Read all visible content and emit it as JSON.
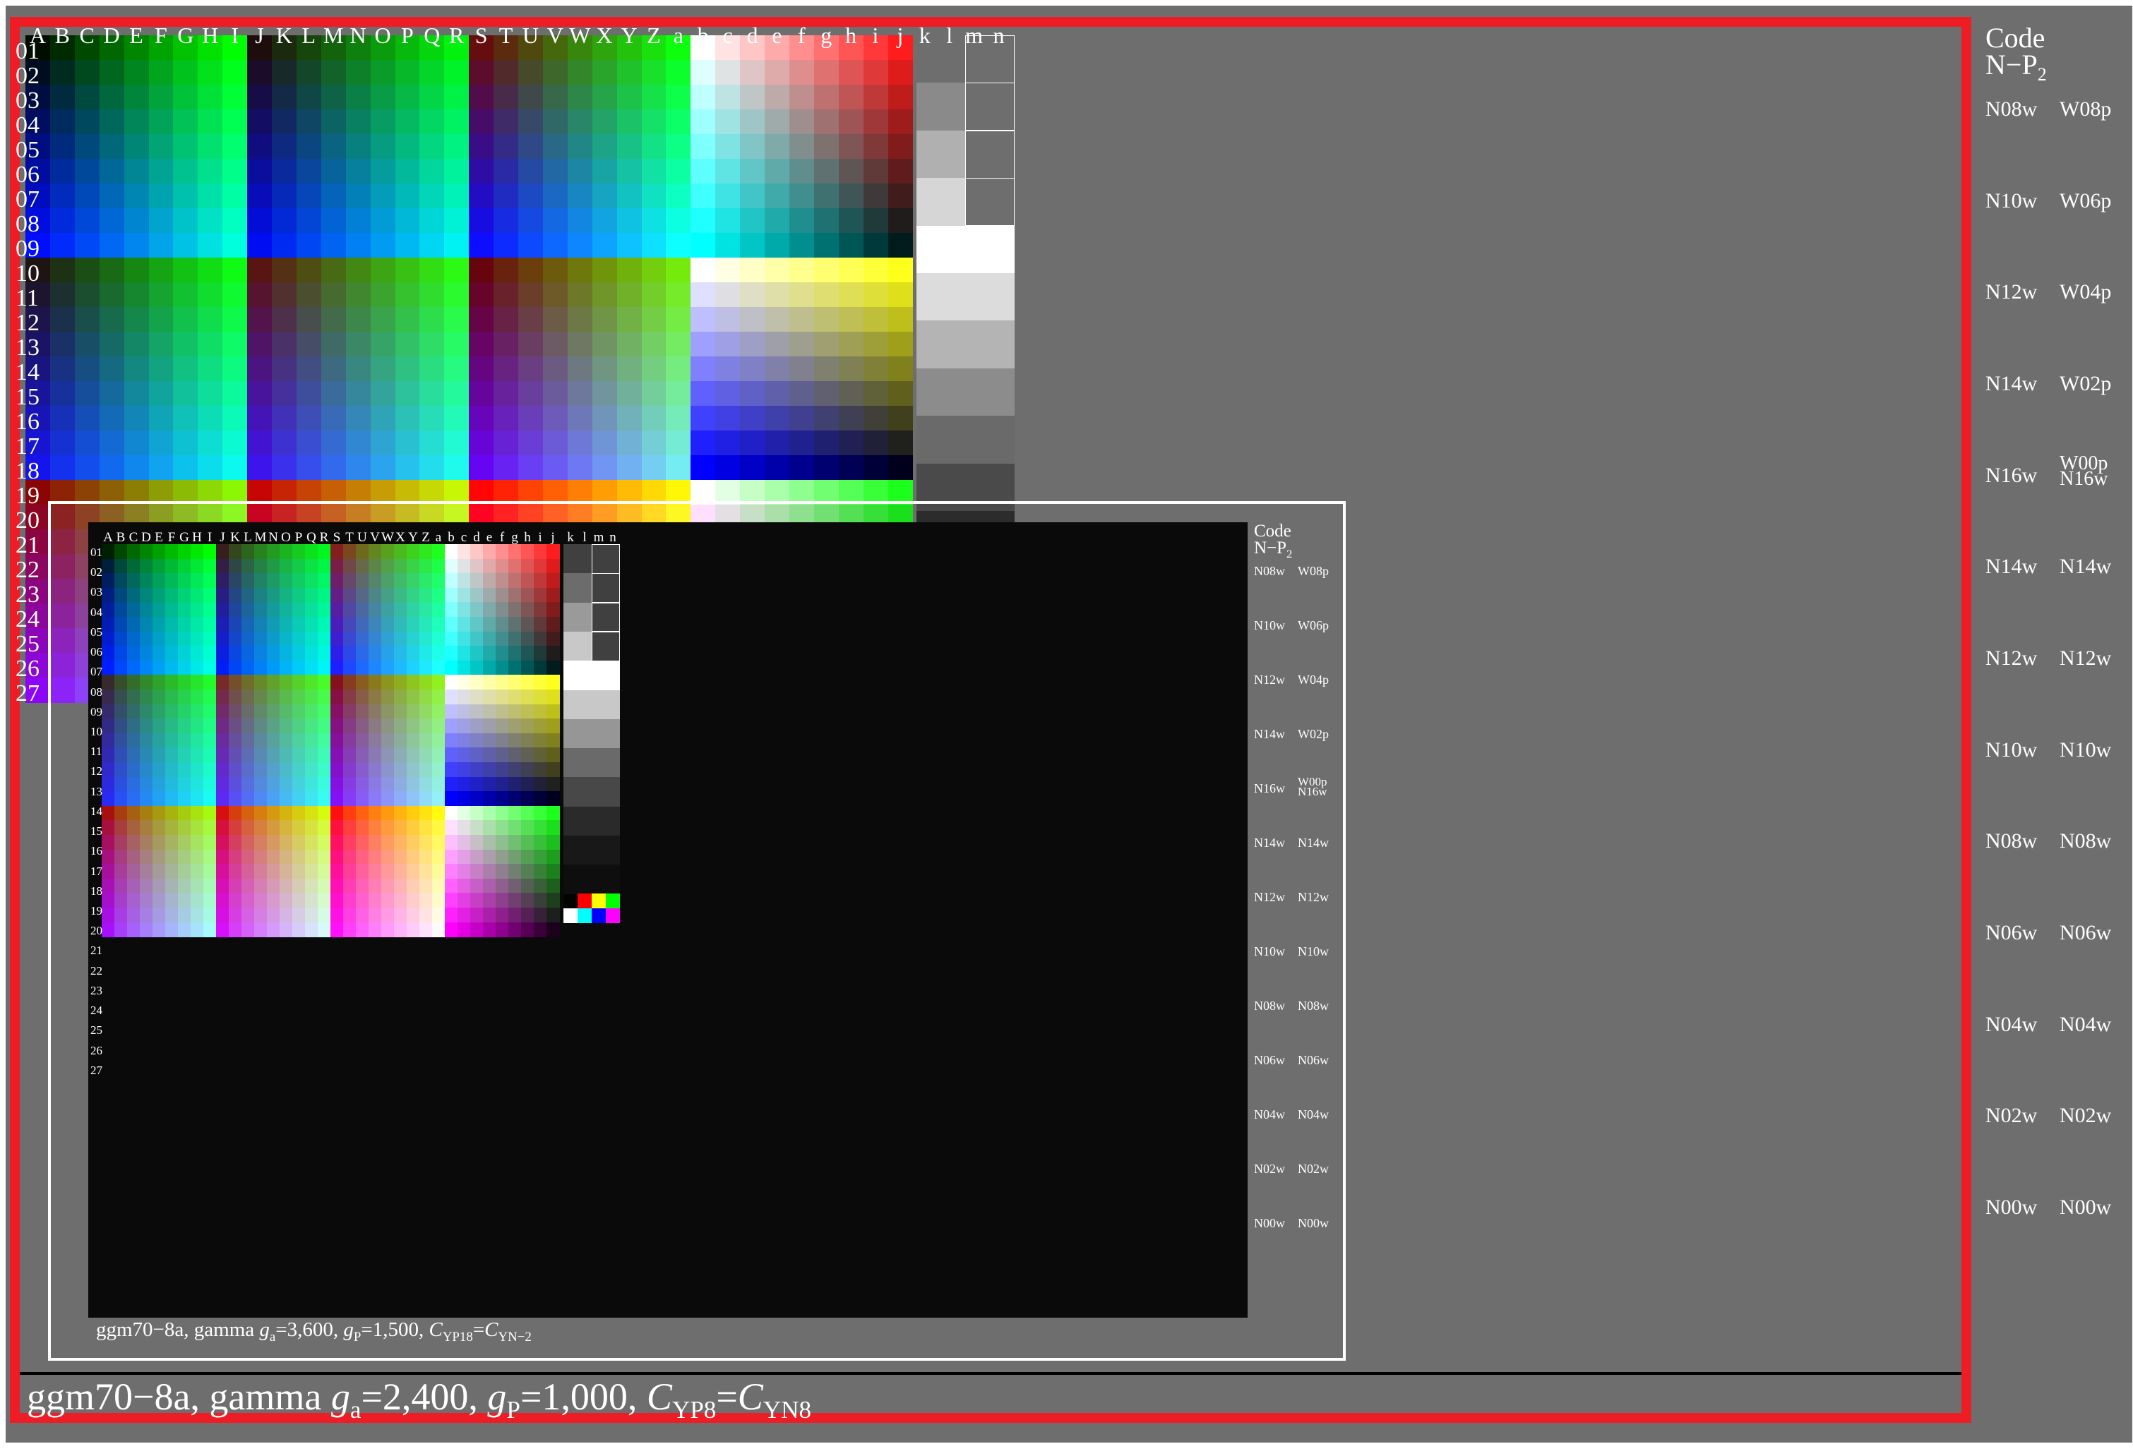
{
  "top_col_letters": [
    "A",
    "B",
    "C",
    "D",
    "E",
    "F",
    "G",
    "H",
    "I",
    "J",
    "K",
    "L",
    "M",
    "N",
    "O",
    "P",
    "Q",
    "R",
    "S",
    "T",
    "U",
    "V",
    "W",
    "X",
    "Y",
    "Z",
    "a",
    "b",
    "c",
    "d",
    "e",
    "f",
    "g",
    "h",
    "i",
    "j",
    "k",
    "l",
    "m",
    "n"
  ],
  "row_numbers": [
    "01",
    "02",
    "03",
    "04",
    "05",
    "06",
    "07",
    "08",
    "09",
    "10",
    "11",
    "12",
    "13",
    "14",
    "15",
    "16",
    "17",
    "18",
    "19",
    "20",
    "21",
    "22",
    "23",
    "24",
    "25",
    "26",
    "27"
  ],
  "code_header": {
    "line1": "Code",
    "line2": "N−P",
    "sub": "2"
  },
  "right_codes": [
    {
      "n": "N08w",
      "w": "W08p"
    },
    {
      "n": "N10w",
      "w": "W06p"
    },
    {
      "n": "N12w",
      "w": "W04p"
    },
    {
      "n": "N14w",
      "w": "W02p"
    },
    {
      "n": "N16w",
      "w": "W00p",
      "w2": "N16w"
    },
    {
      "n": "N14w",
      "w": "N14w"
    },
    {
      "n": "N12w",
      "w": "N12w"
    },
    {
      "n": "N10w",
      "w": "N10w"
    },
    {
      "n": "N08w",
      "w": "N08w"
    },
    {
      "n": "N06w",
      "w": "N06w"
    },
    {
      "n": "N04w",
      "w": "N04w"
    },
    {
      "n": "N02w",
      "w": "N02w"
    },
    {
      "n": "N00w",
      "w": "N00w"
    }
  ],
  "caption_main": {
    "pre": "ggm70−8a, gamma ",
    "g": "g",
    "a": "a",
    "eq1": "=2,400, ",
    "g2": "g",
    "p": "P",
    "eq2": "=1,000, ",
    "c": "C",
    "yp": "YP8",
    "eq3": "=",
    "c2": "C",
    "yn": "YN8"
  },
  "caption_inset": {
    "pre": "ggm70−8a, gamma ",
    "g": "g",
    "a": "a",
    "eq1": "=3,600, ",
    "g2": "g",
    "p": "P",
    "eq2": "=1,500, ",
    "c": "C",
    "yp": "YP18",
    "eq3": "=",
    "c2": "C",
    "yn": "YN−2"
  },
  "colors": {
    "background_gray": "#6e6e6e",
    "frame_red": "#ee1c24",
    "text": "#ffffff"
  }
}
